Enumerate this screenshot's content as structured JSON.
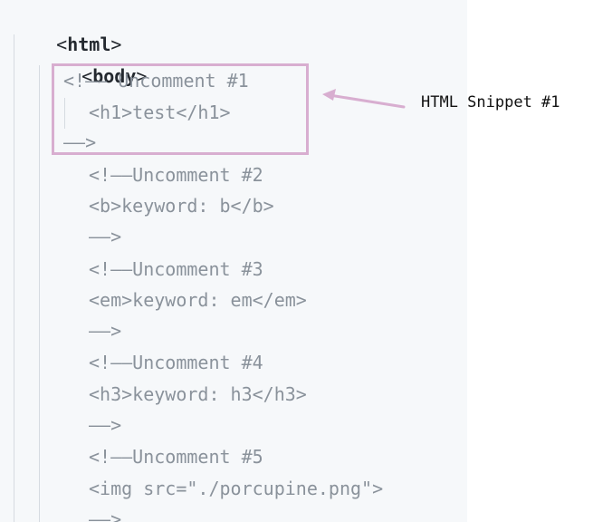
{
  "code": {
    "html_open_lt": "<",
    "html_tag": "html",
    "html_open_gt": ">",
    "body_open_lt": "<",
    "body_tag": "body",
    "body_open_gt": ">",
    "lines": [
      {
        "text": "<!—— Uncomment #1"
      },
      {
        "text": "<h1>test</h1>"
      },
      {
        "text": "——>"
      },
      {
        "text": "<!——Uncomment #2"
      },
      {
        "text": "<b>keyword: b</b>"
      },
      {
        "text": "——>"
      },
      {
        "text": "<!——Uncomment #3"
      },
      {
        "text": "<em>keyword: em</em>"
      },
      {
        "text": "——>"
      },
      {
        "text": "<!——Uncomment #4"
      },
      {
        "text": "<h3>keyword: h3</h3>"
      },
      {
        "text": "——>"
      },
      {
        "text": "<!——Uncomment #5"
      },
      {
        "text": "<img src=\"./porcupine.png\">"
      },
      {
        "text": "——>"
      }
    ]
  },
  "annotation": {
    "label": "HTML Snippet #1",
    "color": "#d8aed0"
  }
}
